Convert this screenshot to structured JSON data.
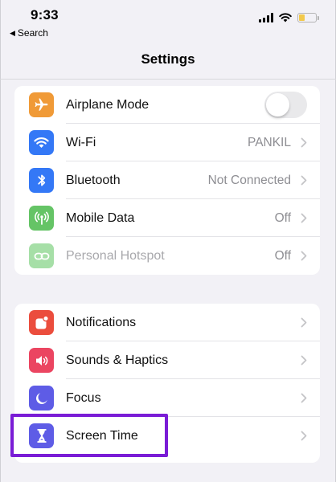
{
  "status_bar": {
    "time": "9:33",
    "back_label": "Search",
    "battery_color": "#f2c94c"
  },
  "nav": {
    "title": "Settings"
  },
  "groups": [
    {
      "rows": [
        {
          "label": "Airplane Mode",
          "value": "",
          "icon": "airplane-icon",
          "color": "#f09a37",
          "toggle": "off"
        },
        {
          "label": "Wi-Fi",
          "value": "PANKIL",
          "icon": "wifi-icon",
          "color": "#3478f6"
        },
        {
          "label": "Bluetooth",
          "value": "Not Connected",
          "icon": "bluetooth-icon",
          "color": "#3478f6"
        },
        {
          "label": "Mobile Data",
          "value": "Off",
          "icon": "antenna-icon",
          "color": "#65c466"
        },
        {
          "label": "Personal Hotspot",
          "value": "Off",
          "icon": "hotspot-icon",
          "color": "#a6dfa7",
          "disabled": true
        }
      ]
    },
    {
      "rows": [
        {
          "label": "Notifications",
          "value": "",
          "icon": "notifications-icon",
          "color": "#eb4d3d"
        },
        {
          "label": "Sounds & Haptics",
          "value": "",
          "icon": "speaker-icon",
          "color": "#eb4561"
        },
        {
          "label": "Focus",
          "value": "",
          "icon": "moon-icon",
          "color": "#5e5ce6"
        },
        {
          "label": "Screen Time",
          "value": "",
          "icon": "hourglass-icon",
          "color": "#5e5ce6"
        }
      ]
    }
  ],
  "highlight_color": "#7a1cd6"
}
